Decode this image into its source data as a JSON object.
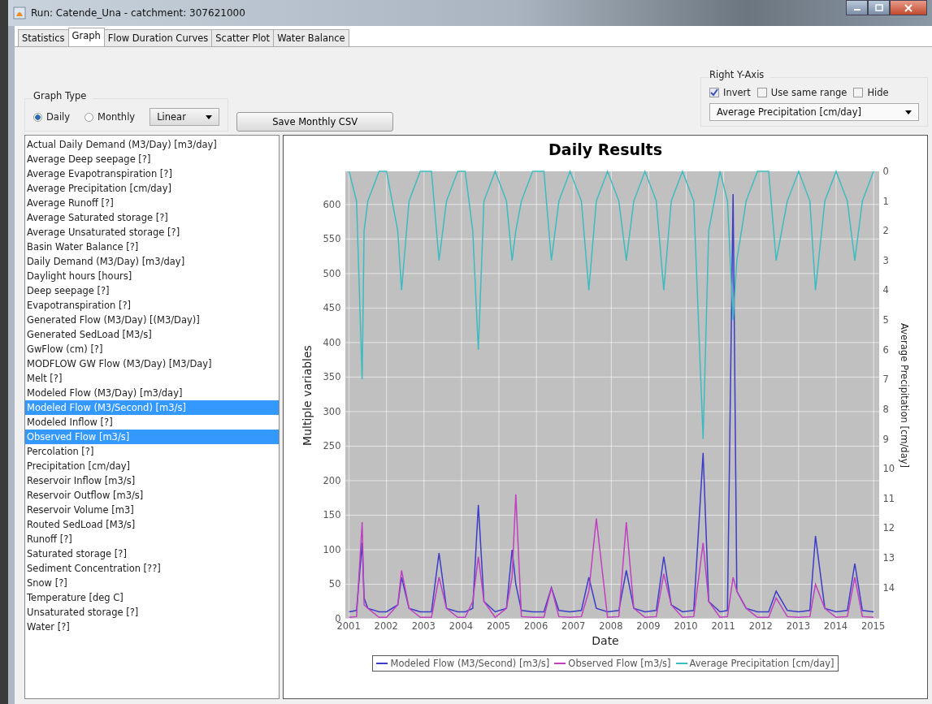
{
  "window": {
    "title": "Run: Catende_Una - catchment: 307621000"
  },
  "tabs": [
    {
      "label": "Statistics",
      "selected": false
    },
    {
      "label": "Graph",
      "selected": true
    },
    {
      "label": "Flow Duration Curves",
      "selected": false
    },
    {
      "label": "Scatter Plot",
      "selected": false
    },
    {
      "label": "Water Balance",
      "selected": false
    }
  ],
  "graph_type": {
    "title": "Graph Type",
    "options": [
      {
        "label": "Daily",
        "selected": true
      },
      {
        "label": "Monthly",
        "selected": false
      }
    ],
    "scale": "Linear"
  },
  "save_button": "Save Monthly CSV",
  "right_axis": {
    "title": "Right Y-Axis",
    "options": [
      {
        "label": "Invert",
        "checked": true
      },
      {
        "label": "Use same range",
        "checked": false
      },
      {
        "label": "Hide",
        "checked": false
      }
    ],
    "variable": "Average Precipitation [cm/day]"
  },
  "variables": [
    {
      "label": "Actual Daily Demand (M3/Day) [m3/day]",
      "selected": false
    },
    {
      "label": "Average Deep seepage [?]",
      "selected": false
    },
    {
      "label": "Average Evapotranspiration [?]",
      "selected": false
    },
    {
      "label": "Average Precipitation [cm/day]",
      "selected": false
    },
    {
      "label": "Average Runoff [?]",
      "selected": false
    },
    {
      "label": "Average Saturated storage [?]",
      "selected": false
    },
    {
      "label": "Average Unsaturated storage [?]",
      "selected": false
    },
    {
      "label": "Basin Water Balance [?]",
      "selected": false
    },
    {
      "label": "Daily Demand (M3/Day) [m3/day]",
      "selected": false
    },
    {
      "label": "Daylight hours [hours]",
      "selected": false
    },
    {
      "label": "Deep seepage [?]",
      "selected": false
    },
    {
      "label": "Evapotranspiration [?]",
      "selected": false
    },
    {
      "label": "Generated Flow (M3/Day) [(M3/Day)]",
      "selected": false
    },
    {
      "label": "Generated SedLoad [M3/s]",
      "selected": false
    },
    {
      "label": "GwFlow (cm) [?]",
      "selected": false
    },
    {
      "label": "MODFLOW GW Flow (M3/Day) [M3/Day]",
      "selected": false
    },
    {
      "label": "Melt [?]",
      "selected": false
    },
    {
      "label": "Modeled Flow (M3/Day) [m3/day]",
      "selected": false
    },
    {
      "label": "Modeled Flow (M3/Second) [m3/s]",
      "selected": true
    },
    {
      "label": "Modeled Inflow [?]",
      "selected": false
    },
    {
      "label": "Observed Flow [m3/s]",
      "selected": true
    },
    {
      "label": "Percolation [?]",
      "selected": false
    },
    {
      "label": "Precipitation [cm/day]",
      "selected": false
    },
    {
      "label": "Reservoir Inflow [m3/s]",
      "selected": false
    },
    {
      "label": "Reservoir Outflow [m3/s]",
      "selected": false
    },
    {
      "label": "Reservoir Volume [m3]",
      "selected": false
    },
    {
      "label": "Routed SedLoad [M3/s]",
      "selected": false
    },
    {
      "label": "Runoff [?]",
      "selected": false
    },
    {
      "label": "Saturated storage [?]",
      "selected": false
    },
    {
      "label": "Sediment Concentration [??]",
      "selected": false
    },
    {
      "label": "Snow [?]",
      "selected": false
    },
    {
      "label": "Temperature [deg C]",
      "selected": false
    },
    {
      "label": "Unsaturated storage [?]",
      "selected": false
    },
    {
      "label": "Water [?]",
      "selected": false
    }
  ],
  "chart": {
    "chart_data": {
      "type": "line",
      "title": "Daily Results",
      "xlabel": "Date",
      "ylabel": "Multiple variables",
      "y2label": "Average Precipitation [cm/day]",
      "grid": true,
      "legend": "bottom",
      "xlim": [
        2000.9,
        2015.15
      ],
      "ylim": [
        0,
        648
      ],
      "y2lim": [
        15.05,
        0
      ],
      "xticks": [
        2001,
        2002,
        2003,
        2004,
        2005,
        2006,
        2007,
        2008,
        2009,
        2010,
        2011,
        2012,
        2013,
        2014,
        2015
      ],
      "yticks": [
        0,
        50,
        100,
        150,
        200,
        250,
        300,
        350,
        400,
        450,
        500,
        550,
        600
      ],
      "y2ticks": [
        0,
        1,
        2,
        3,
        4,
        5,
        6,
        7,
        8,
        9,
        10,
        11,
        12,
        13,
        14
      ],
      "x": [
        2001.0,
        2001.2,
        2001.35,
        2001.4,
        2001.5,
        2001.8,
        2002.0,
        2002.3,
        2002.4,
        2002.6,
        2002.9,
        2003.2,
        2003.4,
        2003.6,
        2003.9,
        2004.1,
        2004.3,
        2004.45,
        2004.6,
        2004.9,
        2005.2,
        2005.35,
        2005.45,
        2005.6,
        2005.9,
        2006.2,
        2006.4,
        2006.6,
        2006.9,
        2007.2,
        2007.4,
        2007.6,
        2007.9,
        2008.2,
        2008.4,
        2008.6,
        2008.9,
        2009.2,
        2009.4,
        2009.6,
        2009.9,
        2010.2,
        2010.45,
        2010.6,
        2010.9,
        2011.1,
        2011.25,
        2011.35,
        2011.6,
        2011.9,
        2012.2,
        2012.4,
        2012.7,
        2013.0,
        2013.3,
        2013.45,
        2013.7,
        2014.0,
        2014.3,
        2014.5,
        2014.7,
        2015.0
      ],
      "series": [
        {
          "name": "Modeled Flow (M3/Second) [m3/s]",
          "color": "#3c3cc8",
          "values": [
            10,
            12,
            110,
            30,
            15,
            10,
            10,
            20,
            60,
            15,
            10,
            10,
            95,
            15,
            10,
            10,
            15,
            165,
            25,
            10,
            15,
            100,
            50,
            12,
            10,
            10,
            45,
            12,
            10,
            12,
            60,
            15,
            10,
            12,
            70,
            15,
            10,
            12,
            90,
            20,
            10,
            12,
            240,
            25,
            10,
            12,
            615,
            40,
            15,
            10,
            10,
            40,
            12,
            10,
            12,
            120,
            15,
            10,
            12,
            80,
            12,
            10
          ]
        },
        {
          "name": "Observed Flow [m3/s]",
          "color": "#c040c0",
          "values": [
            2,
            3,
            140,
            20,
            15,
            2,
            2,
            20,
            70,
            15,
            2,
            2,
            60,
            15,
            2,
            2,
            25,
            90,
            25,
            2,
            15,
            60,
            180,
            3,
            2,
            2,
            45,
            3,
            2,
            3,
            40,
            145,
            2,
            3,
            140,
            15,
            2,
            3,
            65,
            20,
            2,
            3,
            110,
            25,
            2,
            3,
            60,
            40,
            15,
            2,
            2,
            30,
            3,
            2,
            3,
            50,
            15,
            2,
            3,
            60,
            3,
            2
          ]
        },
        {
          "name": "Average Precipitation [cm/day]",
          "color": "#3cbcc0",
          "axis": "y2",
          "values": [
            0,
            1,
            7,
            2,
            1,
            0,
            0,
            2,
            4,
            1,
            0,
            0,
            3,
            1,
            0,
            0,
            2,
            6,
            1,
            0,
            1,
            3,
            2,
            1,
            0,
            0,
            3,
            1,
            0,
            1,
            4,
            1,
            0,
            1,
            3,
            1,
            0,
            1,
            4,
            1,
            0,
            1,
            9,
            2,
            0,
            1,
            5,
            3,
            1,
            0,
            0,
            3,
            1,
            0,
            1,
            4,
            1,
            0,
            1,
            3,
            1,
            0
          ]
        }
      ]
    }
  }
}
